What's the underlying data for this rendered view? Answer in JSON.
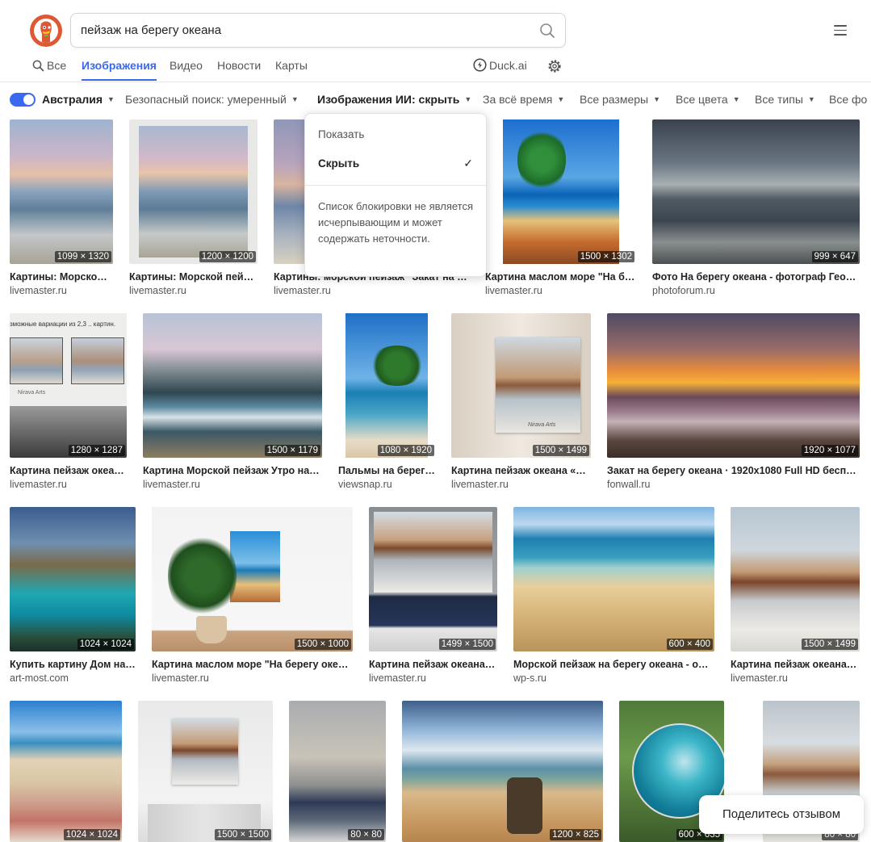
{
  "search": {
    "query": "пейзаж на берегу океана"
  },
  "tabs": [
    {
      "label": "Все"
    },
    {
      "label": "Изображения"
    },
    {
      "label": "Видео"
    },
    {
      "label": "Новости"
    },
    {
      "label": "Карты"
    }
  ],
  "duckai_label": "Duck.ai",
  "filters": {
    "region": "Австралия",
    "safe_search": "Безопасный поиск: умеренный",
    "ai_images": "Изображения ИИ: скрыть",
    "time": "За всё время",
    "size": "Все размеры",
    "color": "Все цвета",
    "type": "Все типы",
    "layout": "Все фо"
  },
  "dropdown": {
    "show": "Показать",
    "hide": "Скрыть",
    "check": "✓",
    "note": "Список блокировки не является исчерпывающим и может содержать неточности."
  },
  "images": [
    {
      "dim": "1099 × 1320",
      "caption": "Картины: Морской…",
      "source": "livemaster.ru"
    },
    {
      "dim": "1200 × 1200",
      "caption": "Картины: Морской пейз…",
      "source": "livemaster.ru"
    },
    {
      "dim": "",
      "caption": "Картины: морской пейзаж \"Закат на …",
      "source": "livemaster.ru"
    },
    {
      "dim": "1500 × 1302",
      "caption": "Картина маслом море \"На б…",
      "source": "livemaster.ru"
    },
    {
      "dim": "999 × 647",
      "caption": "Фото На берегу океана - фотограф Гео…",
      "source": "photoforum.ru"
    },
    {
      "dim": "1280 × 1287",
      "caption": "Картина пейзаж океа…",
      "source": "livemaster.ru"
    },
    {
      "dim": "1500 × 1179",
      "caption": "Картина Морской пейзаж Утро на…",
      "source": "livemaster.ru"
    },
    {
      "dim": "1080 × 1920",
      "caption": "Пальмы на берег…",
      "source": "viewsnap.ru"
    },
    {
      "dim": "1500 × 1499",
      "caption": "Картина пейзаж океана «…",
      "source": "livemaster.ru"
    },
    {
      "dim": "1920 × 1077",
      "caption": "Закат на берегу океана · 1920x1080 Full HD бесп…",
      "source": "fonwall.ru"
    },
    {
      "dim": "1024 × 1024",
      "caption": "Купить картину Дом на…",
      "source": "art-most.com"
    },
    {
      "dim": "1500 × 1000",
      "caption": "Картина маслом море \"На берегу оке…",
      "source": "livemaster.ru"
    },
    {
      "dim": "1499 × 1500",
      "caption": "Картина пейзаж океана…",
      "source": "livemaster.ru"
    },
    {
      "dim": "600 × 400",
      "caption": "Морской пейзаж на берегу океана - о…",
      "source": "wp-s.ru"
    },
    {
      "dim": "1500 × 1499",
      "caption": "Картина пейзаж океана…",
      "source": "livemaster.ru"
    },
    {
      "dim": "1024 × 1024",
      "caption": "",
      "source": ""
    },
    {
      "dim": "1500 × 1500",
      "caption": "",
      "source": ""
    },
    {
      "dim": "80 × 80",
      "caption": "",
      "source": ""
    },
    {
      "dim": "1200 × 825",
      "caption": "",
      "source": ""
    },
    {
      "dim": "600 × 635",
      "caption": "",
      "source": ""
    },
    {
      "dim": "80 × 80",
      "caption": "",
      "source": ""
    }
  ],
  "image_overlay_text": {
    "variations": "зможные вариации из 2,3 .. картин.",
    "brand_nirava": "Nirava Arts",
    "brand_script": "Nirava Arts"
  },
  "feedback_label": "Поделитесь отзывом",
  "colors": {
    "accent": "#3969ef",
    "logo": "#de5833"
  }
}
